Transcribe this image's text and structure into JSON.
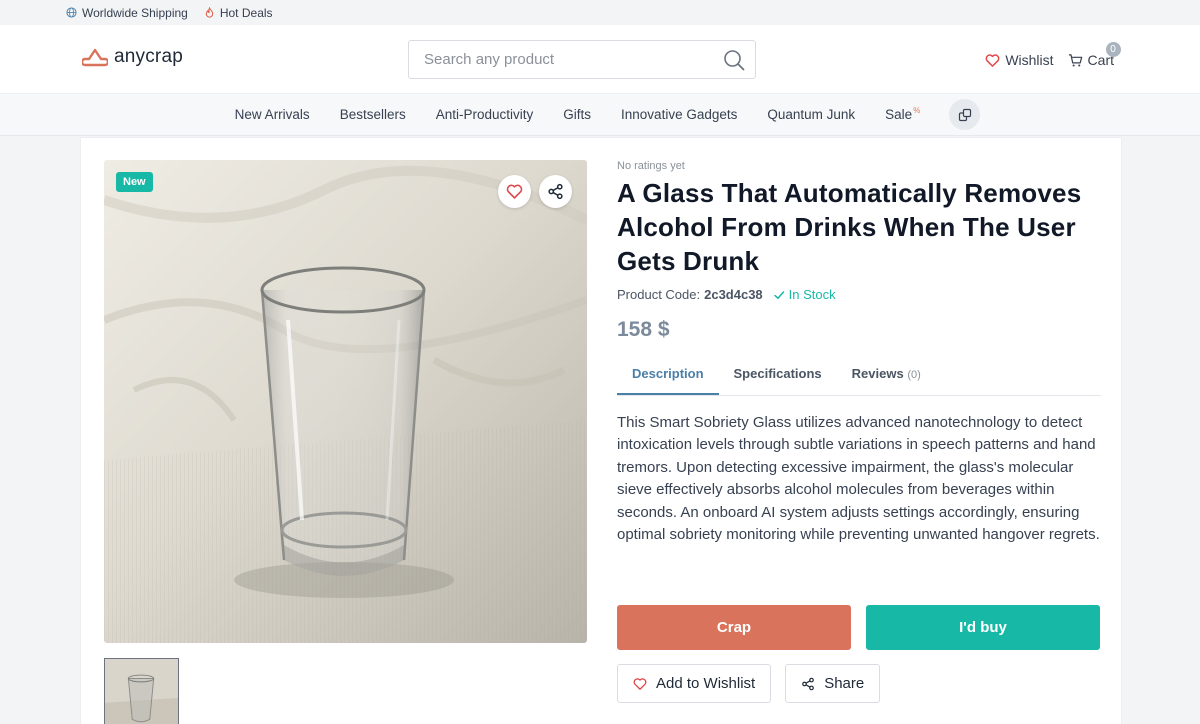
{
  "topbar": {
    "shipping_label": "Worldwide Shipping",
    "deals_label": "Hot Deals"
  },
  "header": {
    "logo_text": "anycrap",
    "search_placeholder": "Search any product",
    "wishlist_label": "Wishlist",
    "cart_label": "Cart",
    "cart_count": "0"
  },
  "nav": {
    "items": [
      "New Arrivals",
      "Bestsellers",
      "Anti-Productivity",
      "Gifts",
      "Innovative Gadgets",
      "Quantum Junk",
      "Sale"
    ],
    "sale_badge": "%"
  },
  "product": {
    "badge": "New",
    "rating_text": "No ratings yet",
    "title": "A Glass That Automatically Removes Alcohol From Drinks When The User Gets Drunk",
    "code_label": "Product Code:",
    "code": "2c3d4c38",
    "stock": "In Stock",
    "price": "158 $",
    "tabs": [
      {
        "label": "Description",
        "count": ""
      },
      {
        "label": "Specifications",
        "count": ""
      },
      {
        "label": "Reviews",
        "count": "(0)"
      }
    ],
    "description": "This Smart Sobriety Glass utilizes advanced nanotechnology to detect intoxication levels through subtle variations in speech patterns and hand tremors. Upon detecting excessive impairment, the glass's molecular sieve effectively absorbs alcohol molecules from beverages within seconds. An onboard AI system adjusts settings accordingly, ensuring optimal sobriety monitoring while preventing unwanted hangover regrets."
  },
  "actions": {
    "crap_label": "Crap",
    "buy_label": "I'd buy",
    "wishlist_label": "Add to Wishlist",
    "share_label": "Share"
  },
  "colors": {
    "accent_teal": "#17b8a6",
    "accent_coral": "#d9735c",
    "tab_active": "#4b7fa6",
    "price": "#7b8a9c"
  }
}
